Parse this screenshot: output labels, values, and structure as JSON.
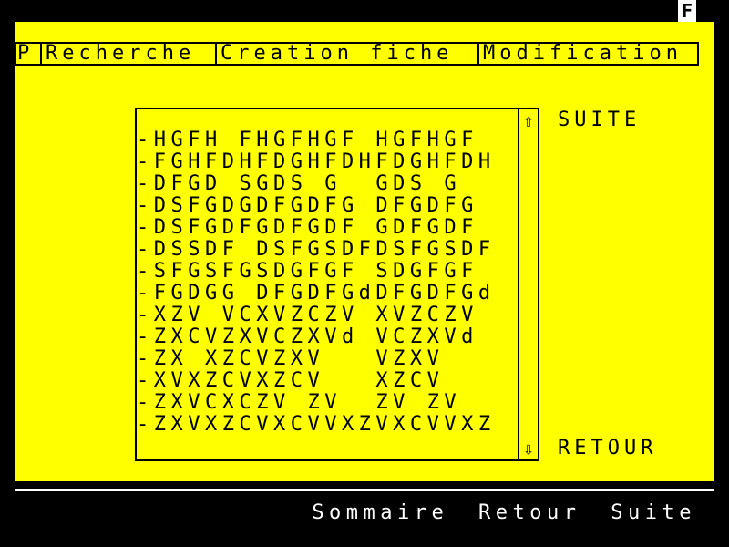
{
  "indicator": "F",
  "menu": {
    "p": "P",
    "recherche": "Recherche",
    "creation": "Creation fiche",
    "modification": "Modification"
  },
  "list": {
    "lines": [
      "-HGFH FHGFHGF HGFHGF",
      "-FGHFDHFDGHFDHFDGHFDH",
      "-DFGD SGDS G  GDS G",
      "-DSFGDGDFGDFG DFGDFG",
      "-DSFGDFGDFGDF GDFGDF",
      "-DSSDF DSFGSDFDSFGSDF",
      "-SFGSFGSDGFGF SDGFGF",
      "-FGDGG DFGDFGdDFGDFGd",
      "-XZV VCXVZCZV XVZCZV",
      "-ZXCVZXVCZXVd VCZXVd",
      "-ZX XZCVZXV   VZXV",
      "-XVXZCVXZCV   XZCV",
      "-ZXVCXCZV ZV  ZV ZV",
      "-ZXVXZCVXCVVXZVXCVVXZ"
    ],
    "scroll_up": "⇧",
    "scroll_down": "⇩"
  },
  "side": {
    "suite": "SUITE",
    "retour": "RETOUR"
  },
  "bottom": {
    "sommaire": "Sommaire",
    "retour": "Retour",
    "suite": "Suite"
  }
}
